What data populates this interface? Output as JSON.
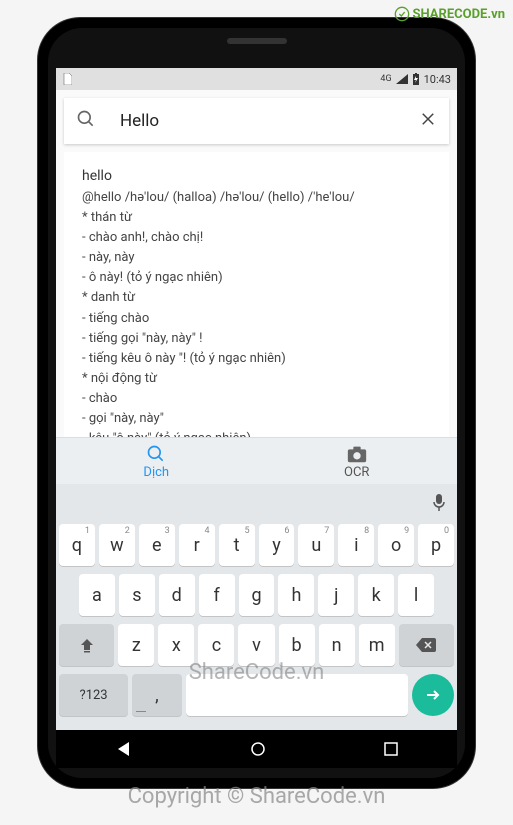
{
  "logo_text": "SHARECODE.vn",
  "status": {
    "network": "4G",
    "time": "10:43"
  },
  "search": {
    "value": "Hello"
  },
  "entry": {
    "headword": "hello",
    "phonetic": "@hello /hə'lou/ (halloa) /hə'lou/ (hello) /'he'lou/",
    "lines": [
      "* thán từ",
      "- chào anh!, chào chị!",
      "- này, này",
      "- ô này! (tỏ ý ngạc nhiên)",
      "* danh từ",
      "- tiếng chào",
      "- tiếng gọi \"này, này\" !",
      "- tiếng kêu ô này \"! (tỏ ý ngạc nhiên)",
      "* nội động từ",
      "- chào",
      "- gọi \"này, này\"",
      "- kêu \"ô này\" (tỏ ý ngạc nhiên)"
    ]
  },
  "tabs": {
    "dich": "Dịch",
    "ocr": "OCR"
  },
  "keyboard": {
    "row1": [
      "q",
      "w",
      "e",
      "r",
      "t",
      "y",
      "u",
      "i",
      "o",
      "p"
    ],
    "row1sup": [
      "1",
      "2",
      "3",
      "4",
      "5",
      "6",
      "7",
      "8",
      "9",
      "0"
    ],
    "row2": [
      "a",
      "s",
      "d",
      "f",
      "g",
      "h",
      "j",
      "k",
      "l"
    ],
    "row3": [
      "z",
      "x",
      "c",
      "v",
      "b",
      "n",
      "m"
    ],
    "sym": "?123",
    "comma": ","
  },
  "watermarks": {
    "w1": "ShareCode.vn",
    "w2": "Copyright © ShareCode.vn"
  }
}
